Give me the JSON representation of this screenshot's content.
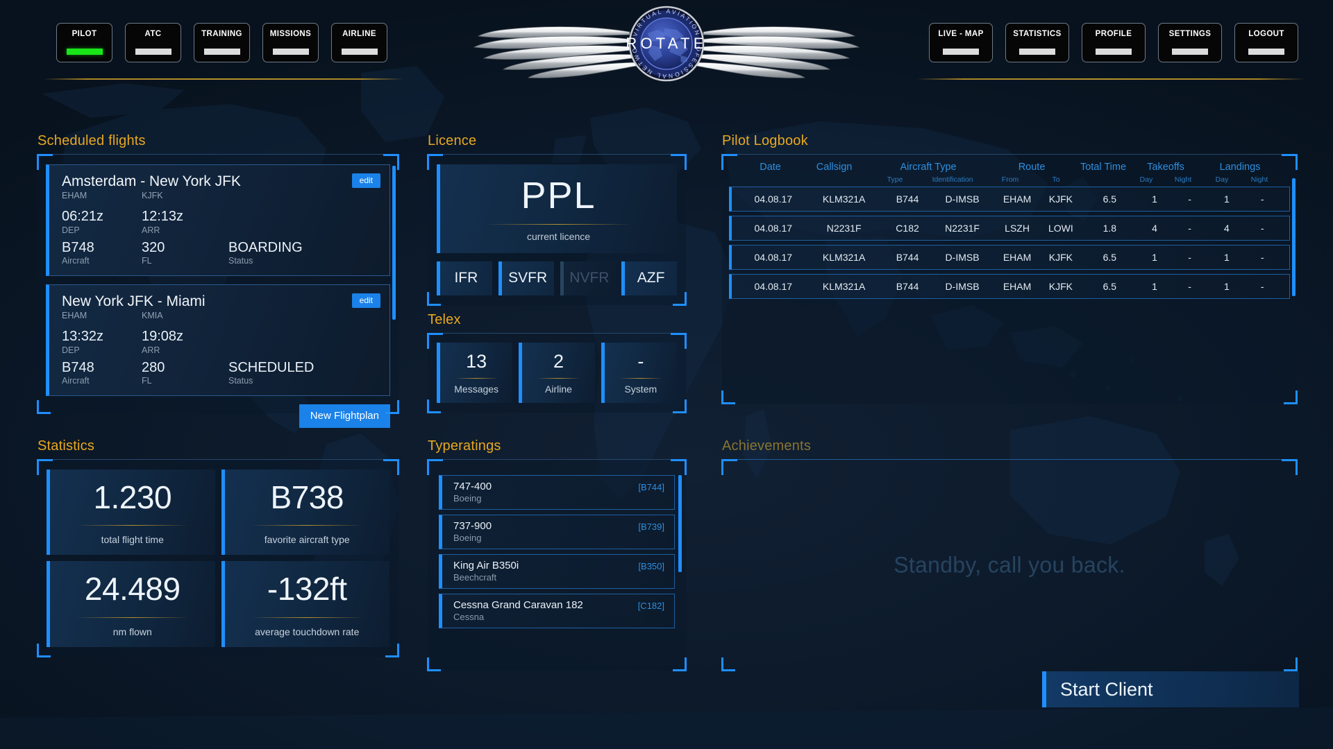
{
  "brand": {
    "logo_text": "ROTATE",
    "logo_ring_text": "PROFESSIONAL VIRTUAL AVIATION NETWORK"
  },
  "nav": {
    "left": [
      {
        "label": "PILOT",
        "active": true
      },
      {
        "label": "ATC",
        "active": false
      },
      {
        "label": "TRAINING",
        "active": false
      },
      {
        "label": "MISSIONS",
        "active": false
      },
      {
        "label": "AIRLINE",
        "active": false
      }
    ],
    "right": [
      {
        "label": "LIVE - MAP",
        "active": false
      },
      {
        "label": "STATISTICS",
        "active": false
      },
      {
        "label": "PROFILE",
        "active": false
      },
      {
        "label": "SETTINGS",
        "active": false
      },
      {
        "label": "LOGOUT",
        "active": false
      }
    ]
  },
  "scheduled_flights": {
    "title": "Scheduled flights",
    "new_flightplan_label": "New Flightplan",
    "edit_label": "edit",
    "labels": {
      "dep": "DEP",
      "arr": "ARR",
      "aircraft": "Aircraft",
      "fl": "FL",
      "status": "Status"
    },
    "flights": [
      {
        "route_title": "Amsterdam - New York JFK",
        "dep_icao": "EHAM",
        "arr_icao": "KJFK",
        "dep_time": "06:21z",
        "arr_time": "12:13z",
        "aircraft": "B748",
        "fl": "320",
        "status": "BOARDING"
      },
      {
        "route_title": "New York JFK - Miami",
        "dep_icao": "EHAM",
        "arr_icao": "KMIA",
        "dep_time": "13:32z",
        "arr_time": "19:08z",
        "aircraft": "B748",
        "fl": "280",
        "status": "SCHEDULED"
      }
    ]
  },
  "licence": {
    "title": "Licence",
    "code": "PPL",
    "caption": "current licence",
    "ratings": [
      {
        "label": "IFR",
        "enabled": true
      },
      {
        "label": "SVFR",
        "enabled": true
      },
      {
        "label": "NVFR",
        "enabled": false
      },
      {
        "label": "AZF",
        "enabled": true
      }
    ]
  },
  "telex": {
    "title": "Telex",
    "tiles": [
      {
        "value": "13",
        "caption": "Messages"
      },
      {
        "value": "2",
        "caption": "Airline"
      },
      {
        "value": "-",
        "caption": "System"
      }
    ]
  },
  "statistics": {
    "title": "Statistics",
    "tiles": [
      {
        "value": "1.230",
        "caption": "total flight time"
      },
      {
        "value": "B738",
        "caption": "favorite aircraft type"
      },
      {
        "value": "24.489",
        "caption": "nm flown"
      },
      {
        "value": "-132ft",
        "caption": "average touchdown rate"
      }
    ]
  },
  "typeratings": {
    "title": "Typeratings",
    "items": [
      {
        "name": "747-400",
        "maker": "Boeing",
        "code": "[B744]"
      },
      {
        "name": "737-900",
        "maker": "Boeing",
        "code": "[B739]"
      },
      {
        "name": "King Air B350i",
        "maker": "Beechcraft",
        "code": "[B350]"
      },
      {
        "name": "Cessna Grand Caravan 182",
        "maker": "Cessna",
        "code": "[C182]"
      }
    ]
  },
  "logbook": {
    "title": "Pilot Logbook",
    "headers": {
      "date": "Date",
      "callsign": "Callsign",
      "aircraft_type": "Aircraft Type",
      "aircraft_type_sub": {
        "type": "Type",
        "identification": "Identification"
      },
      "route": "Route",
      "route_sub": {
        "from": "From",
        "to": "To"
      },
      "total_time": "Total Time",
      "takeoffs": "Takeoffs",
      "takeoffs_sub": {
        "day": "Day",
        "night": "Night"
      },
      "landings": "Landings",
      "landings_sub": {
        "day": "Day",
        "night": "Night"
      }
    },
    "rows": [
      {
        "date": "04.08.17",
        "callsign": "KLM321A",
        "type": "B744",
        "identification": "D-IMSB",
        "from": "EHAM",
        "to": "KJFK",
        "total_time": "6.5",
        "to_day": "1",
        "to_night": "-",
        "ld_day": "1",
        "ld_night": "-"
      },
      {
        "date": "04.08.17",
        "callsign": "N2231F",
        "type": "C182",
        "identification": "N2231F",
        "from": "LSZH",
        "to": "LOWI",
        "total_time": "1.8",
        "to_day": "4",
        "to_night": "-",
        "ld_day": "4",
        "ld_night": "-"
      },
      {
        "date": "04.08.17",
        "callsign": "KLM321A",
        "type": "B744",
        "identification": "D-IMSB",
        "from": "EHAM",
        "to": "KJFK",
        "total_time": "6.5",
        "to_day": "1",
        "to_night": "-",
        "ld_day": "1",
        "ld_night": "-"
      },
      {
        "date": "04.08.17",
        "callsign": "KLM321A",
        "type": "B744",
        "identification": "D-IMSB",
        "from": "EHAM",
        "to": "KJFK",
        "total_time": "6.5",
        "to_day": "1",
        "to_night": "-",
        "ld_day": "1",
        "ld_night": "-"
      }
    ]
  },
  "achievements": {
    "title": "Achievements",
    "placeholder": "Standby, call you back."
  },
  "start_client": {
    "label": "Start Client"
  },
  "colors": {
    "accent_blue": "#1f8fff",
    "gold": "#e8a820",
    "active_green": "#19e619",
    "background": "#0a1726",
    "text": "#eaf1f8"
  }
}
